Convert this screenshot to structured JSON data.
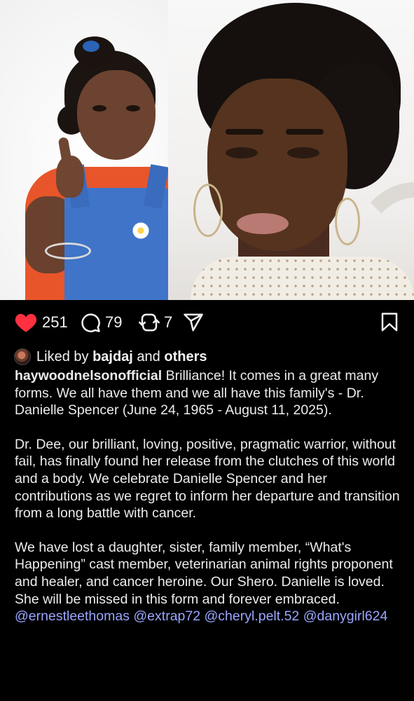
{
  "post": {
    "actions": {
      "likes": "251",
      "comments": "79",
      "reposts": "7",
      "like_color": "#ff3040",
      "icons": [
        "heart-icon",
        "comment-icon",
        "repost-icon",
        "share-icon",
        "bookmark-icon"
      ]
    },
    "liked_by": {
      "prefix": "Liked by",
      "user": "bajdaj",
      "and": "and",
      "others": "others"
    },
    "caption": {
      "username": "haywoodnelsonofficial",
      "p1": "Brilliance! It comes in a great many forms. We all have them and we all have this family's - Dr. Danielle Spencer (June 24, 1965 - August 11, 2025).",
      "p2": "Dr. Dee, our brilliant, loving, positive, pragmatic warrior, without fail, has finally found her release from the clutches of this world and a body. We celebrate Danielle Spencer and her contributions as we regret to inform her departure and transition from a long battle with cancer.",
      "p3": "We have lost a daughter, sister, family member, “What's Happening” cast member, veterinarian animal rights proponent and healer, and cancer heroine. Our Shero. Danielle is loved. She will be missed in this form and forever embraced.",
      "mentions": [
        "@ernestleethomas",
        "@extrap72",
        "@cheryl.pelt.52",
        "@danygirl624"
      ],
      "mention_color": "#9aa6ff"
    }
  }
}
